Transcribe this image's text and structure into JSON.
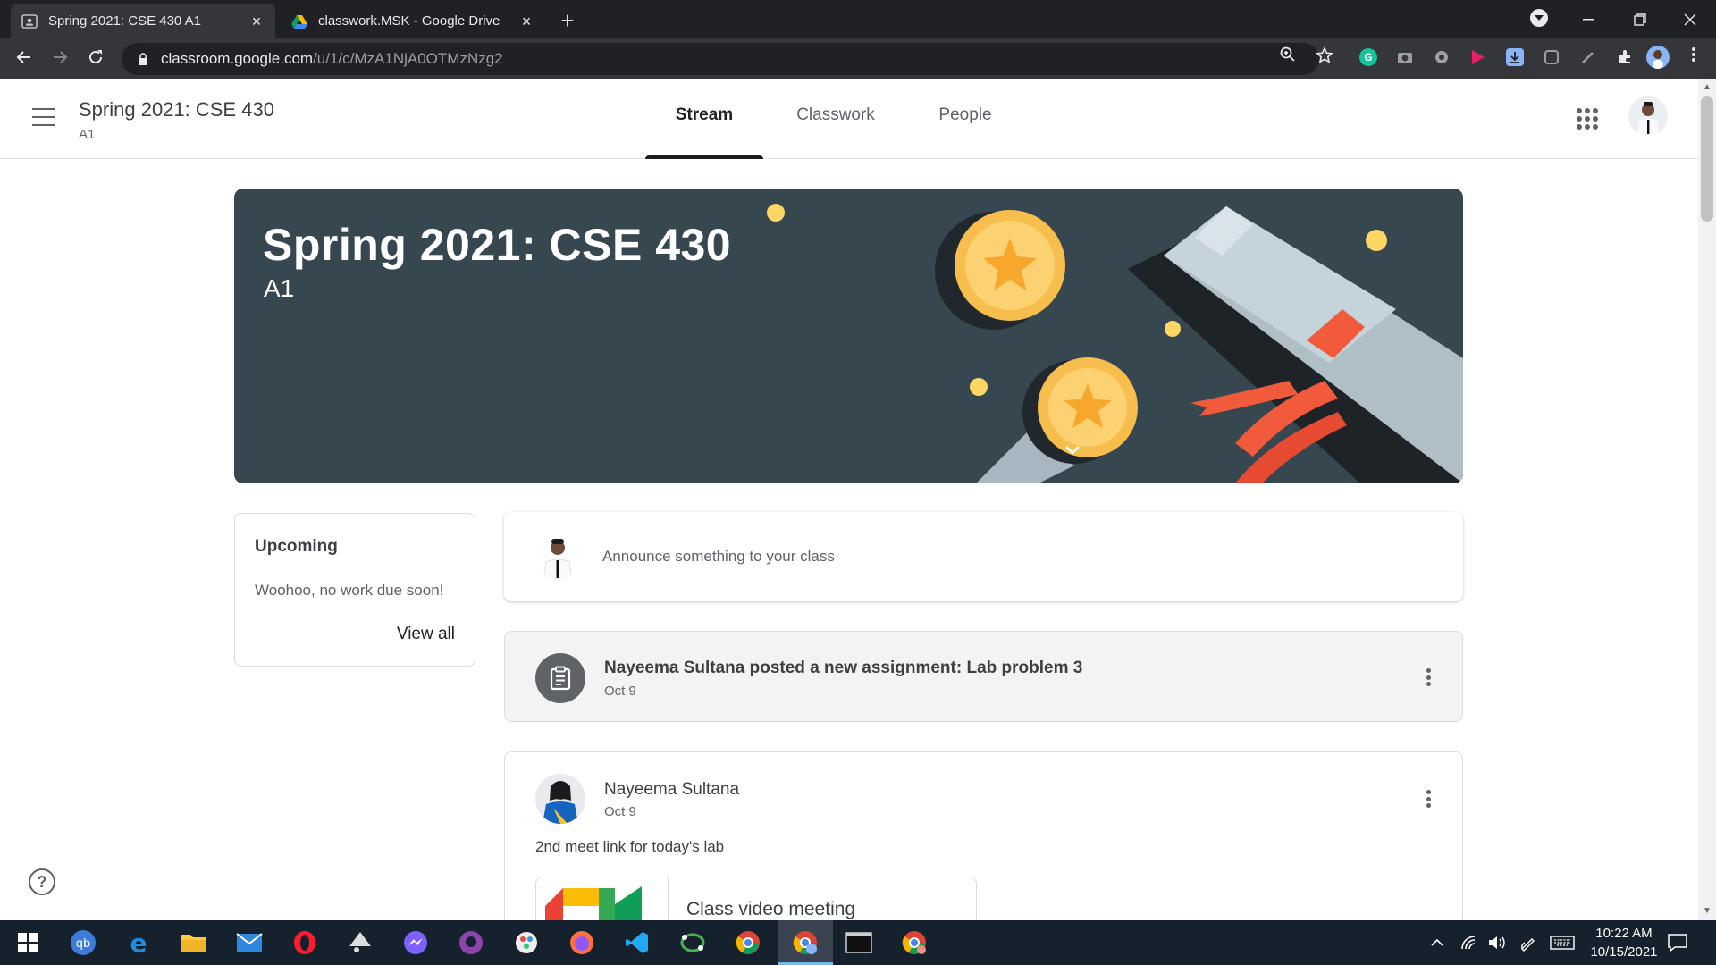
{
  "browser": {
    "tabs": [
      {
        "title": "Spring 2021: CSE 430 A1",
        "active": true
      },
      {
        "title": "classwork.MSK - Google Drive",
        "active": false
      }
    ],
    "url_host": "classroom.google.com",
    "url_path": "/u/1/c/MzA1NjA0OTMzNzg2"
  },
  "header": {
    "class_title": "Spring 2021: CSE 430",
    "class_section": "A1",
    "tabs": [
      {
        "label": "Stream",
        "active": true
      },
      {
        "label": "Classwork",
        "active": false
      },
      {
        "label": "People",
        "active": false
      }
    ]
  },
  "banner": {
    "title": "Spring 2021: CSE 430",
    "section": "A1",
    "background": "#37474f"
  },
  "upcoming": {
    "heading": "Upcoming",
    "message": "Woohoo, no work due soon!",
    "view_all": "View all"
  },
  "announce": {
    "placeholder": "Announce something to your class"
  },
  "stream": [
    {
      "type": "assignment",
      "title": "Nayeema Sultana posted a new assignment: Lab problem 3",
      "date": "Oct 9"
    },
    {
      "type": "post",
      "author": "Nayeema Sultana",
      "date": "Oct 9",
      "body": "2nd meet link for today's lab",
      "attachment_label": "Class video meeting"
    }
  ],
  "taskbar": {
    "time": "10:22 AM",
    "date": "10/15/2021"
  },
  "icons": {
    "help": "?"
  }
}
